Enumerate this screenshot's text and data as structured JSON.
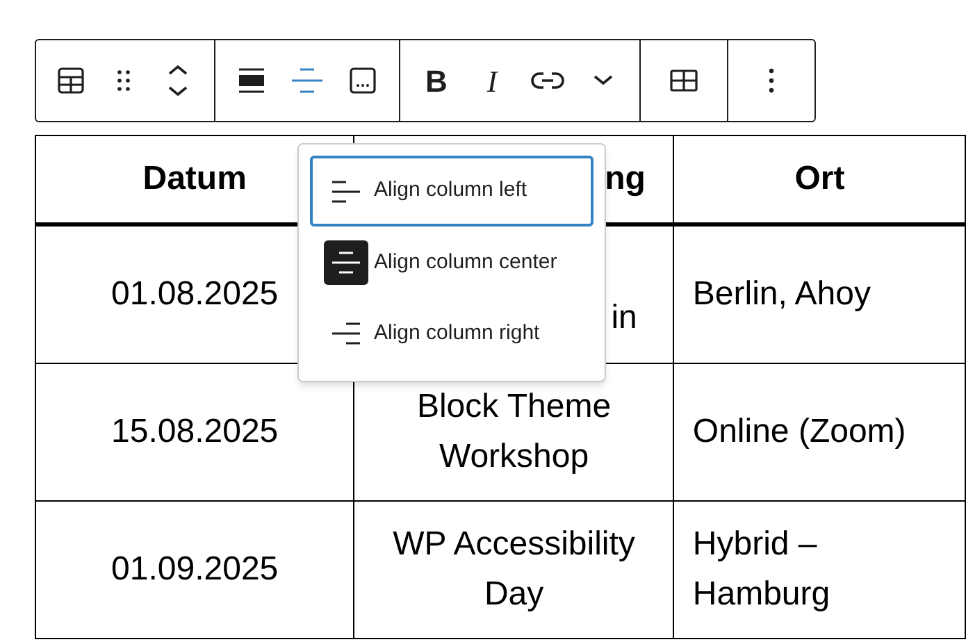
{
  "toolbar": {
    "groups": [
      {
        "buttons": [
          {
            "kind": "table"
          },
          {
            "kind": "drag"
          },
          {
            "kind": "move"
          }
        ]
      },
      {
        "buttons": [
          {
            "kind": "align-wide"
          },
          {
            "kind": "align-column",
            "active": true
          },
          {
            "kind": "caption"
          }
        ]
      },
      {
        "buttons": [
          {
            "kind": "bold",
            "label": "B"
          },
          {
            "kind": "italic",
            "label": "I"
          },
          {
            "kind": "link"
          },
          {
            "kind": "more"
          }
        ]
      },
      {
        "buttons": [
          {
            "kind": "edit-table"
          }
        ]
      },
      {
        "buttons": [
          {
            "kind": "options"
          }
        ]
      }
    ]
  },
  "table": {
    "columns": [
      {
        "label": "Datum"
      },
      {
        "label": "ng",
        "kind": "fragment"
      },
      {
        "label": "Ort"
      }
    ],
    "rows": [
      {
        "cells": [
          {
            "text": "01.08.2025"
          },
          {
            "text": "in",
            "kind": "fragment"
          },
          {
            "text": "Berlin, Ahoy"
          }
        ]
      },
      {
        "cells": [
          {
            "text": "15.08.2025"
          },
          {
            "text": "Block Theme Workshop"
          },
          {
            "text": "Online (Zoom)"
          }
        ]
      },
      {
        "cells": [
          {
            "text": "01.09.2025"
          },
          {
            "text": "WP Accessibility Day"
          },
          {
            "text": "Hybrid – Hamburg"
          }
        ]
      }
    ]
  },
  "menu": {
    "items": [
      {
        "label": "Align column left",
        "selected": false,
        "focused": true
      },
      {
        "label": "Align column center",
        "selected": true,
        "focused": false
      },
      {
        "label": "Align column right",
        "selected": false,
        "focused": false
      }
    ]
  }
}
